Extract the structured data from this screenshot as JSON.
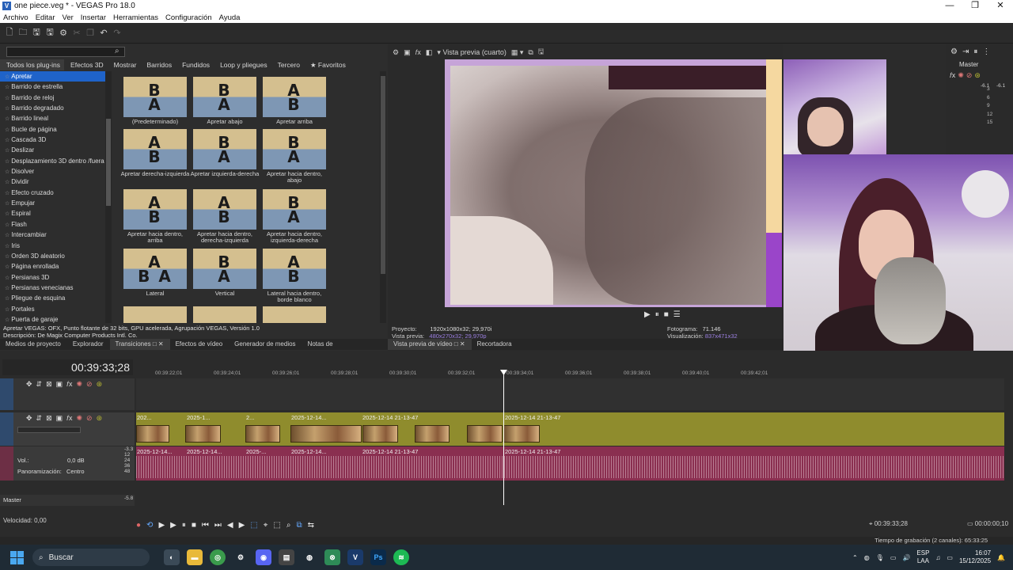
{
  "titlebar": {
    "title": "one piece.veg * - VEGAS Pro 18.0",
    "minimize": "—",
    "maximize": "❐",
    "close": "✕"
  },
  "menu": [
    "Archivo",
    "Editar",
    "Ver",
    "Insertar",
    "Herramientas",
    "Configuración",
    "Ayuda"
  ],
  "plugins": {
    "search_placeholder": "",
    "tabs": [
      "Todos los plug-ins",
      "Efectos 3D",
      "Mostrar",
      "Barridos",
      "Fundidos",
      "Loop y pliegues",
      "Tercero",
      "★ Favoritos"
    ],
    "list": [
      "Apretar",
      "Barrido de estrella",
      "Barrido de reloj",
      "Barrido degradado",
      "Barrido lineal",
      "Bucle de página",
      "Cascada 3D",
      "Deslizar",
      "Desplazamiento 3D dentro /fuera",
      "Disolver",
      "Dividir",
      "Efecto cruzado",
      "Empujar",
      "Espiral",
      "Flash",
      "Intercambiar",
      "Iris",
      "Orden 3D aleatorio",
      "Página enrollada",
      "Persianas 3D",
      "Persianas venecianas",
      "Pliegue de esquina",
      "Portales",
      "Puerta de garaje"
    ],
    "selected": "Apretar",
    "thumbs": [
      {
        "label": "(Predeterminado)",
        "top": "B",
        "bottom": "A"
      },
      {
        "label": "Apretar abajo",
        "top": "B",
        "bottom": "A"
      },
      {
        "label": "Apretar arriba",
        "top": "A",
        "bottom": "B"
      },
      {
        "label": "Apretar derecha-izquierda",
        "top": "A",
        "bottom": "B"
      },
      {
        "label": "Apretar izquierda-derecha",
        "top": "B",
        "bottom": "A"
      },
      {
        "label": "Apretar hacia dentro, abajo",
        "top": "B",
        "bottom": "A"
      },
      {
        "label": "Apretar hacia dentro, arriba",
        "top": "A",
        "bottom": "B"
      },
      {
        "label": "Apretar hacia dentro, derecha-izquierda",
        "top": "A",
        "bottom": "B"
      },
      {
        "label": "Apretar hacia dentro, izquierda-derecha",
        "top": "B",
        "bottom": "A"
      },
      {
        "label": "Lateral",
        "top": "A",
        "bottom": "B A"
      },
      {
        "label": "Vertical",
        "top": "B",
        "bottom": "A"
      },
      {
        "label": "Lateral hacia dentro, borde blanco",
        "top": "A",
        "bottom": "B"
      }
    ],
    "desc_line1": "Apretar VEGAS: OFX, Punto flotante de 32 bits, GPU acelerada, Agrupación VEGAS, Versión 1.0",
    "desc_line2": "Descripción: De Magix Computer Products Intl. Co."
  },
  "window_tabs_left": [
    "Medios de proyecto",
    "Explorador",
    "Transiciones",
    "Efectos de vídeo",
    "Generador de medios",
    "Notas de"
  ],
  "preview": {
    "quality": "Vista previa (cuarto)",
    "controls": [
      "▶",
      "⏸",
      "■",
      "☰"
    ],
    "proyecto_label": "Proyecto:",
    "proyecto_value": "1920x1080x32; 29,970i",
    "vista_label": "Vista previa:",
    "vista_value": "480x270x32; 29,970p",
    "fotograma_label": "Fotograma:",
    "fotograma_value": "71.146",
    "visualizacion_label": "Visualización:",
    "visualizacion_value": "837x471x32",
    "tabs": [
      "Vista previa de vídeo",
      "Recortadora"
    ]
  },
  "master": {
    "title": "Master",
    "left_peak": "-6.1",
    "right_peak": "-6.1",
    "scale": [
      "3",
      "6",
      "9",
      "12",
      "15"
    ]
  },
  "timeline": {
    "time": "00:39:33;28",
    "ruler": [
      "00:39:22;01",
      "00:39:24;01",
      "00:39:26;01",
      "00:39:28;01",
      "00:39:30;01",
      "00:39:32;01",
      "00:39:34;01",
      "00:39:36;01",
      "00:39:38;01",
      "00:39:40;01",
      "00:39:42;01"
    ],
    "video_clips": [
      "202...",
      "2025-1...",
      "2...",
      "2025-12-14...",
      "2025-12-14 21-13-47",
      "2025-12-14 21-13-47"
    ],
    "audio_clips": [
      "2025-12-14...",
      "2025-12-14...",
      "2025-...",
      "2025-12-14...",
      "2025-12-14 21-13-47",
      "2025-12-14 21-13-47"
    ],
    "vol_label": "Vol.:",
    "vol_value": "0,0 dB",
    "pan_label": "Panoramización:",
    "pan_value": "Centro",
    "audio_meter": [
      "-3.3",
      "12",
      "24",
      "36",
      "48"
    ],
    "master_label": "Master",
    "master_meter": "-5.8",
    "speed": "Velocidad: 0,00",
    "cursor_time": "00:39:33;28",
    "end_time": "00:00:00;10"
  },
  "status": "Tiempo de grabación (2 canales): 65:33:25",
  "taskbar": {
    "search": "Buscar",
    "lang1": "ESP",
    "lang2": "LAA",
    "time": "16:07",
    "date": "15/12/2025"
  }
}
